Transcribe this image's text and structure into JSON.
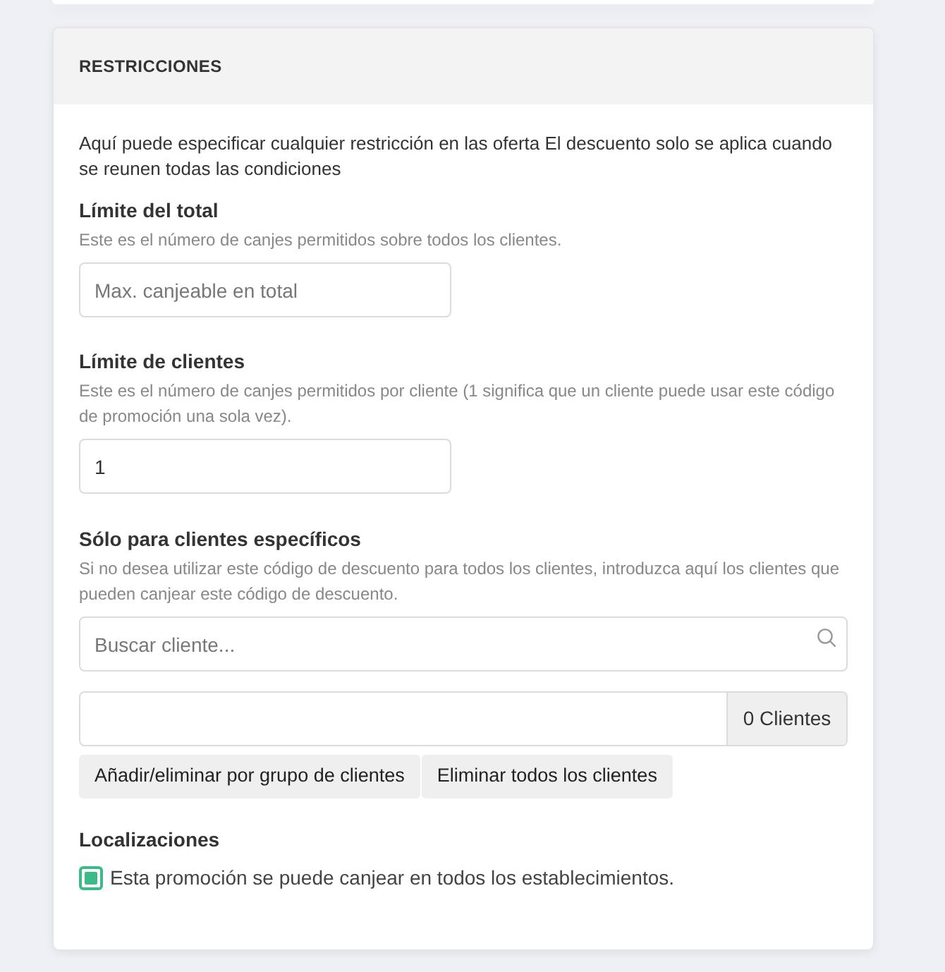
{
  "card_header": {
    "title": "RESTRICCIONES"
  },
  "intro": "Aquí puede especificar cualquier restricción en las oferta El descuento solo se aplica cuando se reunen todas las condiciones",
  "fields": [
    {
      "kind": "input",
      "label": "Límite del total",
      "help": "Este es el número de canjes permitidos sobre todos los clientes.",
      "placeholder": "Max. canjeable en total"
    },
    {
      "kind": "input",
      "label": "Límite de clientes",
      "help": "Este es el número de canjes permitidos por cliente (1 significa que un cliente puede usar este código de promoción una sola vez).",
      "value": "1"
    }
  ],
  "specific_customers": {
    "label": "Sólo para clientes específicos",
    "help": "Si no desea utilizar este código de descuento para todos los clientes, introduzca aquí los clientes que pueden canjear este código de descuento.",
    "search": {
      "placeholder": "Buscar cliente..."
    },
    "count": "0 Clientes",
    "buttons": [
      "Añadir/eliminar por grupo de clientes",
      "Eliminar todos los clientes"
    ]
  },
  "locations": {
    "label": "Localizaciones",
    "checkbox": {
      "label": "Esta promoción se puede canjear en todos los establecimientos.",
      "checked": true
    }
  }
}
